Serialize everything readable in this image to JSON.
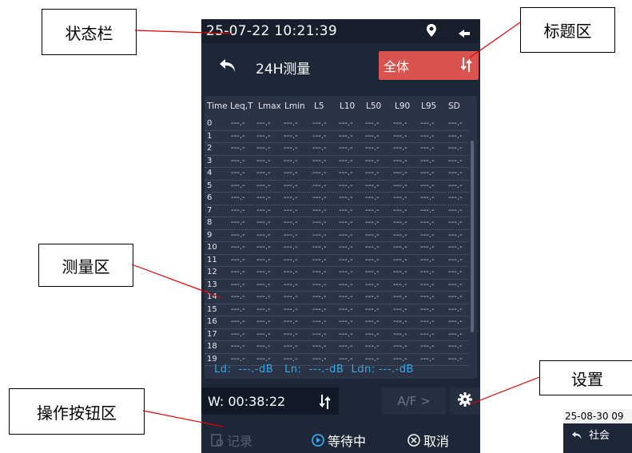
{
  "callouts": {
    "status_bar": "状态栏",
    "title_area": "标题区",
    "measure_area": "测量区",
    "settings": "设置",
    "action_area": "操作按钮区"
  },
  "status": {
    "datetime": "25-07-22 10:21:39",
    "icons": [
      "location-pin-icon",
      "speaker-icon"
    ]
  },
  "header": {
    "title": "24H测量",
    "filter_label": "全体",
    "sort_icon": "sort-icon",
    "back_icon": "back-arrow-icon"
  },
  "table": {
    "columns": [
      "Time",
      "Leq,T",
      "Lmax",
      "Lmin",
      "L5",
      "L10",
      "L50",
      "L90",
      "L95",
      "SD"
    ],
    "rows": [
      {
        "idx": "0",
        "cells": [
          "---.-",
          "---.-",
          "---.-",
          "---.-",
          "---.-",
          "---.-",
          "---.-",
          "---.-",
          "---.-"
        ]
      },
      {
        "idx": "1",
        "cells": [
          "---.-",
          "---.-",
          "---.-",
          "---.-",
          "---.-",
          "---.-",
          "---.-",
          "---.-",
          "---.-"
        ]
      },
      {
        "idx": "2",
        "cells": [
          "---.-",
          "---.-",
          "---.-",
          "---.-",
          "---.-",
          "---.-",
          "---.-",
          "---.-",
          "---.-"
        ]
      },
      {
        "idx": "3",
        "cells": [
          "---.-",
          "---.-",
          "---.-",
          "---.-",
          "---.-",
          "---.-",
          "---.-",
          "---.-",
          "---.-"
        ]
      },
      {
        "idx": "4",
        "cells": [
          "---.-",
          "---.-",
          "---.-",
          "---.-",
          "---.-",
          "---.-",
          "---.-",
          "---.-",
          "---.-"
        ]
      },
      {
        "idx": "5",
        "cells": [
          "---.-",
          "---.-",
          "---.-",
          "---.-",
          "---.-",
          "---.-",
          "---.-",
          "---.-",
          "---.-"
        ]
      },
      {
        "idx": "6",
        "cells": [
          "---.-",
          "---.-",
          "---.-",
          "---.-",
          "---.-",
          "---.-",
          "---.-",
          "---.-",
          "---.-"
        ]
      },
      {
        "idx": "7",
        "cells": [
          "---.-",
          "---.-",
          "---.-",
          "---.-",
          "---.-",
          "---.-",
          "---.-",
          "---.-",
          "---.-"
        ]
      },
      {
        "idx": "8",
        "cells": [
          "---.-",
          "---.-",
          "---.-",
          "---.-",
          "---.-",
          "---.-",
          "---.-",
          "---.-",
          "---.-"
        ]
      },
      {
        "idx": "9",
        "cells": [
          "---.-",
          "---.-",
          "---.-",
          "---.-",
          "---.-",
          "---.-",
          "---.-",
          "---.-",
          "---.-"
        ]
      },
      {
        "idx": "10",
        "cells": [
          "---.-",
          "---.-",
          "---.-",
          "---.-",
          "---.-",
          "---.-",
          "---.-",
          "---.-",
          "---.-"
        ]
      },
      {
        "idx": "11",
        "cells": [
          "---.-",
          "---.-",
          "---.-",
          "---.-",
          "---.-",
          "---.-",
          "---.-",
          "---.-",
          "---.-"
        ]
      },
      {
        "idx": "12",
        "cells": [
          "---.-",
          "---.-",
          "---.-",
          "---.-",
          "---.-",
          "---.-",
          "---.-",
          "---.-",
          "---.-"
        ]
      },
      {
        "idx": "13",
        "cells": [
          "---.-",
          "---.-",
          "---.-",
          "---.-",
          "---.-",
          "---.-",
          "---.-",
          "---.-",
          "---.-"
        ]
      },
      {
        "idx": "14",
        "cells": [
          "---.-",
          "---.-",
          "---.-",
          "---.-",
          "---.-",
          "---.-",
          "---.-",
          "---.-",
          "---.-"
        ]
      },
      {
        "idx": "15",
        "cells": [
          "---.-",
          "---.-",
          "---.-",
          "---.-",
          "---.-",
          "---.-",
          "---.-",
          "---.-",
          "---.-"
        ]
      },
      {
        "idx": "16",
        "cells": [
          "---.-",
          "---.-",
          "---.-",
          "---.-",
          "---.-",
          "---.-",
          "---.-",
          "---.-",
          "---.-"
        ]
      },
      {
        "idx": "17",
        "cells": [
          "---.-",
          "---.-",
          "---.-",
          "---.-",
          "---.-",
          "---.-",
          "---.-",
          "---.-",
          "---.-"
        ]
      },
      {
        "idx": "18",
        "cells": [
          "---.-",
          "---.-",
          "---.-",
          "---.-",
          "---.-",
          "---.-",
          "---.-",
          "---.-",
          "---.-"
        ]
      },
      {
        "idx": "19",
        "cells": [
          "---.-",
          "---.-",
          "---.-",
          "---.-",
          "---.-",
          "---.-",
          "---.-",
          "---.-",
          "---.-"
        ]
      }
    ]
  },
  "summary": {
    "text": "Ld:  ---.-dB   Ln:  ---.-dB  Ldn: ---.-dB"
  },
  "controls": {
    "w_time": "W: 00:38:22",
    "af_label": "A/F >",
    "record_label": "记录",
    "waiting_label": "等待中",
    "cancel_label": "取消"
  },
  "thumbnail": {
    "datetime": "25-08-30 09",
    "title": "社会"
  },
  "colors": {
    "accent_red": "#d9534f",
    "device_bg": "#1d2738",
    "highlight_blue": "#3aa6e6"
  }
}
